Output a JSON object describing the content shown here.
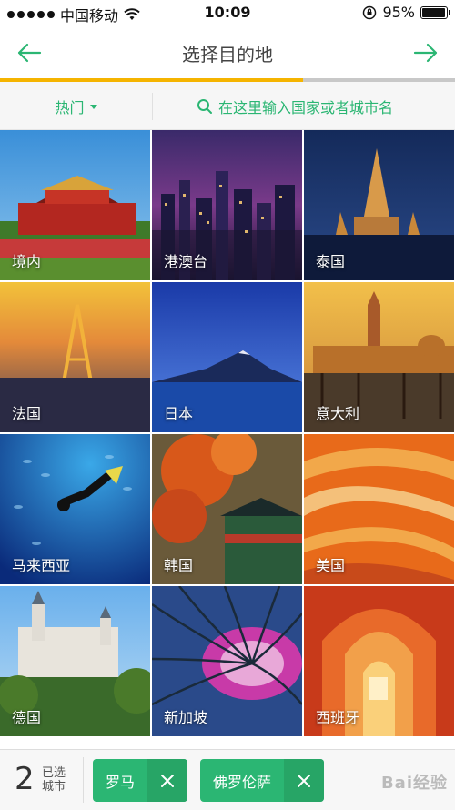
{
  "status_bar": {
    "carrier": "中国移动",
    "time": "10:09",
    "battery": "95%",
    "battery_level": 0.95
  },
  "nav": {
    "title": "选择目的地",
    "back_icon": "arrow-left-icon",
    "next_icon": "arrow-right-icon"
  },
  "filter": {
    "hot_label": "热门",
    "search_placeholder": "在这里输入国家或者城市名"
  },
  "destinations": [
    {
      "label": "境内"
    },
    {
      "label": "港澳台"
    },
    {
      "label": "泰国"
    },
    {
      "label": "法国"
    },
    {
      "label": "日本"
    },
    {
      "label": "意大利"
    },
    {
      "label": "马来西亚"
    },
    {
      "label": "韩国"
    },
    {
      "label": "美国"
    },
    {
      "label": "德国"
    },
    {
      "label": "新加坡"
    },
    {
      "label": "西班牙"
    }
  ],
  "selection": {
    "count": "2",
    "count_label_line1": "已选",
    "count_label_line2": "城市",
    "chips": [
      {
        "label": "罗马"
      },
      {
        "label": "佛罗伦萨"
      }
    ]
  },
  "watermark": "Bai经验",
  "colors": {
    "accent": "#2bb673",
    "progress_active": "#f5b400",
    "progress_inactive": "#c8c8c8"
  }
}
